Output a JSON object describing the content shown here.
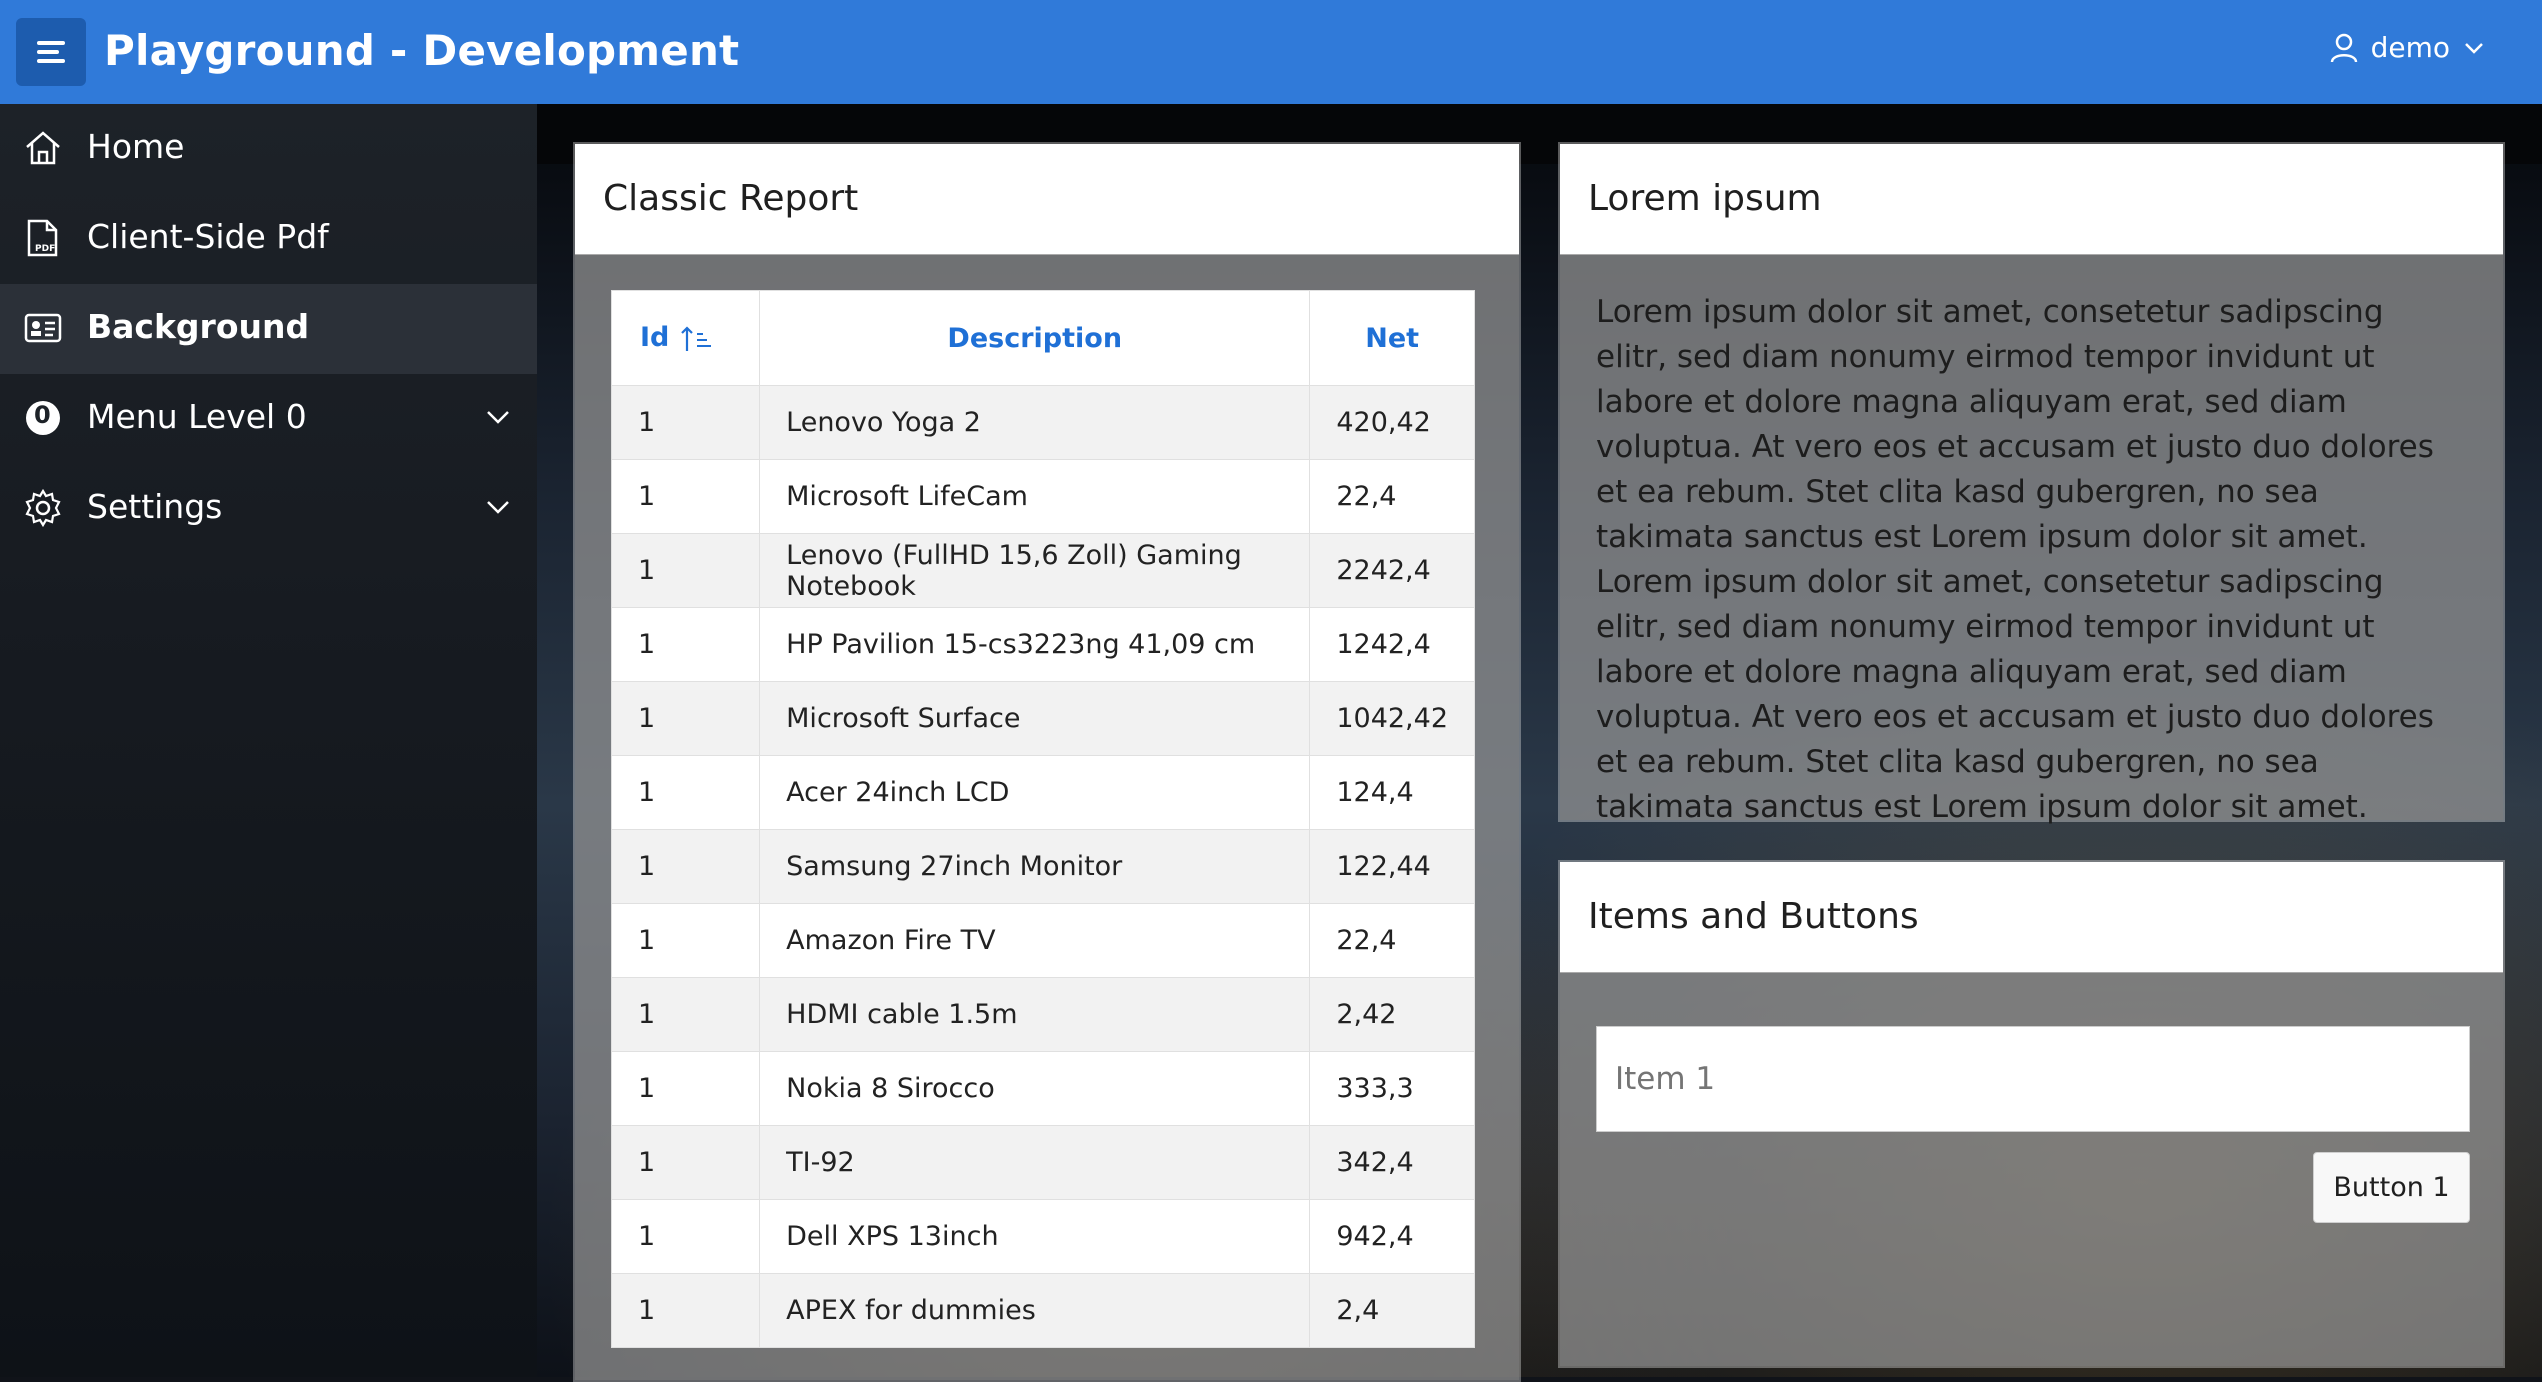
{
  "header": {
    "title": "Playground - Development",
    "user": "demo",
    "color": "#307ad9"
  },
  "sidebar": {
    "items": [
      {
        "label": "Home",
        "icon": "home-icon"
      },
      {
        "label": "Client-Side Pdf",
        "icon": "pdf-file-icon"
      },
      {
        "label": "Background",
        "icon": "id-card-icon",
        "active": true
      },
      {
        "label": "Menu Level 0",
        "icon": "badge-zero-icon",
        "badge": "0",
        "expandable": true
      },
      {
        "label": "Settings",
        "icon": "gear-icon",
        "expandable": true
      }
    ]
  },
  "report": {
    "title": "Classic Report",
    "columns": [
      "Id",
      "Description",
      "Net"
    ],
    "rows": [
      [
        "1",
        "Lenovo Yoga 2",
        "420,42"
      ],
      [
        "1",
        "Microsoft LifeCam",
        "22,4"
      ],
      [
        "1",
        "Lenovo (FullHD 15,6 Zoll) Gaming Notebook",
        "2242,4"
      ],
      [
        "1",
        "HP Pavilion 15-cs3223ng 41,09 cm",
        "1242,4"
      ],
      [
        "1",
        "Microsoft Surface",
        "1042,42"
      ],
      [
        "1",
        "Acer 24inch LCD",
        "124,4"
      ],
      [
        "1",
        "Samsung 27inch Monitor",
        "122,44"
      ],
      [
        "1",
        "Amazon Fire TV",
        "22,4"
      ],
      [
        "1",
        "HDMI cable 1.5m",
        "2,42"
      ],
      [
        "1",
        "Nokia 8 Sirocco",
        "333,3"
      ],
      [
        "1",
        "TI-92",
        "342,4"
      ],
      [
        "1",
        "Dell XPS 13inch",
        "942,4"
      ],
      [
        "1",
        "APEX for dummies",
        "2,4"
      ]
    ]
  },
  "lorem": {
    "title": "Lorem ipsum",
    "text": "Lorem ipsum dolor sit amet, consetetur sadipscing elitr, sed diam nonumy eirmod tempor invidunt ut labore et dolore magna aliquyam erat, sed diam voluptua. At vero eos et accusam et justo duo dolores et ea rebum. Stet clita kasd gubergren, no sea takimata sanctus est Lorem ipsum dolor sit amet. Lorem ipsum dolor sit amet, consetetur sadipscing elitr, sed diam nonumy eirmod tempor invidunt ut labore et dolore magna aliquyam erat, sed diam voluptua. At vero eos et accusam et justo duo dolores et ea rebum. Stet clita kasd gubergren, no sea takimata sanctus est Lorem ipsum dolor sit amet."
  },
  "items_buttons": {
    "title": "Items and Buttons",
    "item_placeholder": "Item 1",
    "button_label": "Button 1"
  }
}
